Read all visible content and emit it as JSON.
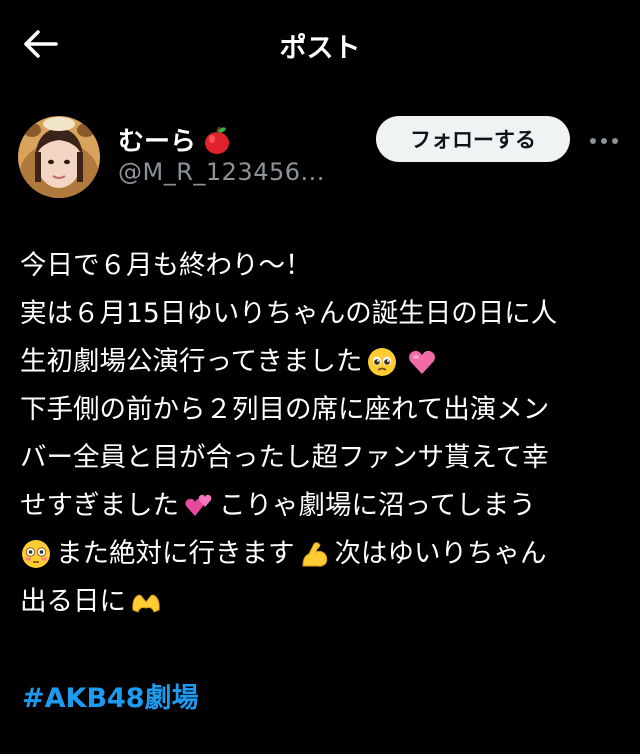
{
  "header": {
    "title": "ポスト"
  },
  "author": {
    "display_name": "むーら",
    "handle": "@M_R_123456...",
    "follow_label": "フォローする"
  },
  "post": {
    "lines": [
      "今日で６月も終わり〜！",
      "実は６月15日ゆいりちゃんの誕生日の日に人",
      "生初劇場公演行ってきました",
      "下手側の前から２列目の席に座れて出演メン",
      "バー全員と目が合ったし超ファンサ貰えて幸",
      "せすぎました",
      "こりゃ劇場に沼ってしまう",
      "また絶対に行きます",
      "次はゆいりちゃん",
      "出る日に"
    ],
    "hashtag": "#AKB48劇場"
  },
  "icons": {
    "back": "arrow-left-icon",
    "more": "more-dots-icon",
    "name_emoji": "red-apple-icon",
    "emoji_1": "pleading-face-icon",
    "emoji_2": "pink-heart-icon",
    "emoji_3": "two-hearts-icon",
    "emoji_4": "flushed-face-icon",
    "emoji_5": "flexed-biceps-icon",
    "emoji_6": "heart-hands-icon"
  },
  "colors": {
    "background": "#000000",
    "text": "#ffffff",
    "secondary": "#8b9299",
    "link": "#1d9bf0",
    "follow_bg": "#eff3f4"
  }
}
